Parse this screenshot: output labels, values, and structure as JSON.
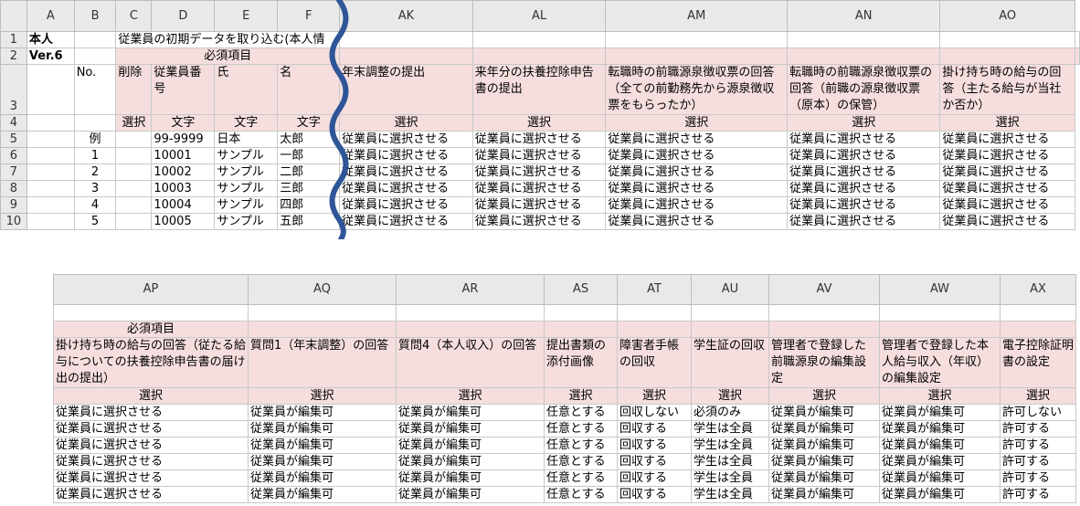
{
  "top": {
    "col_headers": [
      "A",
      "B",
      "C",
      "D",
      "E",
      "F",
      "AK",
      "AL",
      "AM",
      "AN",
      "AO"
    ],
    "row_numbers": [
      "1",
      "2",
      "3",
      "4",
      "5",
      "6",
      "7",
      "8",
      "9",
      "10"
    ],
    "row1": {
      "a": "本人",
      "c": "従業員の初期データを取り込む(本人情"
    },
    "row2": {
      "a": "Ver.6",
      "required": "必須項目"
    },
    "row3": {
      "b": "No.",
      "c": "削除",
      "d": "従業員番号",
      "e": "氏",
      "f": "名",
      "ak": "年末調整の提出",
      "al": "来年分の扶養控除申告書の提出",
      "am": "転職時の前職源泉徴収票の回答（全ての前勤務先から源泉徴収票をもらったか）",
      "an": "転職時の前職源泉徴収票の回答（前職の源泉徴収票（原本）の保管）",
      "ao": "掛け持ち時の給与の回答（主たる給与が当社か否か）"
    },
    "row4": {
      "c": "選択",
      "d": "文字",
      "e": "文字",
      "f": "文字",
      "ak": "選択",
      "al": "選択",
      "am": "選択",
      "an": "選択",
      "ao": "選択"
    },
    "data_rows": [
      {
        "b": "例",
        "d": "99-9999",
        "e": "日本",
        "f": "太郎",
        "v": "従業員に選択させる"
      },
      {
        "b": "1",
        "d": "10001",
        "e": "サンプル",
        "f": "一郎",
        "v": "従業員に選択させる"
      },
      {
        "b": "2",
        "d": "10002",
        "e": "サンプル",
        "f": "二郎",
        "v": "従業員に選択させる"
      },
      {
        "b": "3",
        "d": "10003",
        "e": "サンプル",
        "f": "三郎",
        "v": "従業員に選択させる"
      },
      {
        "b": "4",
        "d": "10004",
        "e": "サンプル",
        "f": "四郎",
        "v": "従業員に選択させる"
      },
      {
        "b": "5",
        "d": "10005",
        "e": "サンプル",
        "f": "五郎",
        "v": "従業員に選択させる"
      }
    ]
  },
  "bottom": {
    "col_headers": [
      "AP",
      "AQ",
      "AR",
      "AS",
      "AT",
      "AU",
      "AV",
      "AW",
      "AX"
    ],
    "required": "必須項目",
    "headers": [
      "掛け持ち時の給与の回答（従たる給与についての扶養控除申告書の届け出の提出）",
      "質問1（年末調整）の回答",
      "質問4（本人収入）の回答",
      "提出書類の添付画像",
      "障害者手帳の回収",
      "学生証の回収",
      "管理者で登録した前職源泉の編集設定",
      "管理者で登録した本人給与収入（年収）の編集設定",
      "電子控除証明書の設定"
    ],
    "types": [
      "選択",
      "選択",
      "選択",
      "選択",
      "選択",
      "選択",
      "選択",
      "選択",
      "選択"
    ],
    "rows": [
      [
        "従業員に選択させる",
        "従業員が編集可",
        "従業員が編集可",
        "任意とする",
        "回収しない",
        "必須のみ",
        "従業員が編集可",
        "従業員が編集可",
        "許可しない"
      ],
      [
        "従業員に選択させる",
        "従業員が編集可",
        "従業員が編集可",
        "任意とする",
        "回収する",
        "学生は全員",
        "従業員が編集可",
        "従業員が編集可",
        "許可する"
      ],
      [
        "従業員に選択させる",
        "従業員が編集可",
        "従業員が編集可",
        "任意とする",
        "回収する",
        "学生は全員",
        "従業員が編集可",
        "従業員が編集可",
        "許可する"
      ],
      [
        "従業員に選択させる",
        "従業員が編集可",
        "従業員が編集可",
        "任意とする",
        "回収する",
        "学生は全員",
        "従業員が編集可",
        "従業員が編集可",
        "許可する"
      ],
      [
        "従業員に選択させる",
        "従業員が編集可",
        "従業員が編集可",
        "任意とする",
        "回収する",
        "学生は全員",
        "従業員が編集可",
        "従業員が編集可",
        "許可する"
      ],
      [
        "従業員に選択させる",
        "従業員が編集可",
        "従業員が編集可",
        "任意とする",
        "回収する",
        "学生は全員",
        "従業員が編集可",
        "従業員が編集可",
        "許可する"
      ]
    ]
  },
  "colors": {
    "header_bg": "#e9e9e9",
    "pink": "#f6dede",
    "squiggle": "#2e5597"
  },
  "icons": {
    "break": "wavy-break-line"
  }
}
